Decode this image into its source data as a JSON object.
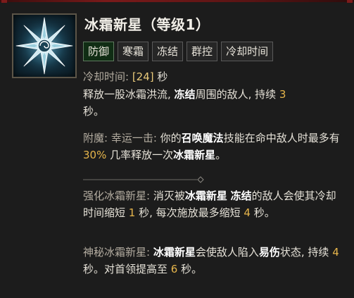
{
  "skill": {
    "name": "冰霜新星（等级1）",
    "icon": "frost-nova-snowflake-icon"
  },
  "tags": [
    "防御",
    "寒霜",
    "冻结",
    "群控",
    "冷却时间"
  ],
  "cooldown": {
    "label": "冷却时间: ",
    "value": "[24]",
    "unit": " 秒"
  },
  "description": {
    "part1": "释放一股冰霜洪流, ",
    "kw_freeze": "冻结",
    "part2": "周围的敌人, 持续 ",
    "duration": "3",
    "part3": "秒。"
  },
  "enchant": {
    "label": "附魔: 幸运一击: ",
    "part1": "你的",
    "kw_summon": "召唤魔法",
    "part2": "技能在命中敌人时最多有 ",
    "chance": "30%",
    "part3": " 几率释放一次",
    "kw_nova": "冰霜新星",
    "part4": "。"
  },
  "upgrade1": {
    "label": "强化冰霜新星: ",
    "part1": "消灭被",
    "kw_nova": "冰霜新星",
    "kw_freeze": "冻结",
    "part2": "的敌人会使其冷却时间缩短 ",
    "value1": "1",
    "part3": " 秒, 每次施放最多缩短 ",
    "value2": "4",
    "part4": " 秒。"
  },
  "upgrade2": {
    "label": "神秘冰霜新星: ",
    "kw_nova": "冰霜新星",
    "part1": "会使敌人陷入",
    "kw_vulnerable": "易伤",
    "part2": "状态, 持续 ",
    "value1": "4",
    "part3": " 秒。对首领提高至 ",
    "value2": "6",
    "part4": " 秒。"
  },
  "colors": {
    "active_tag_bg": "#102d14",
    "number": "#e6b54b",
    "top_border": "#7a1a1a"
  }
}
